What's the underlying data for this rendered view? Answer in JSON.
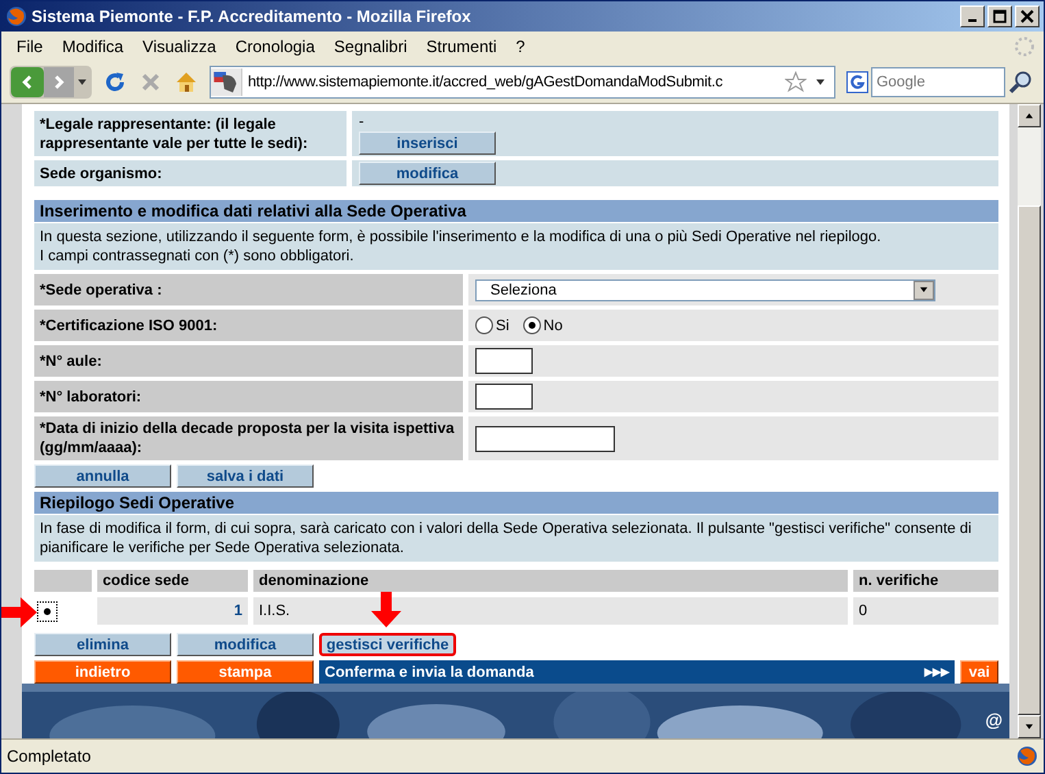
{
  "window": {
    "title": "Sistema Piemonte - F.P. Accreditamento - Mozilla Firefox"
  },
  "menu": [
    "File",
    "Modifica",
    "Visualizza",
    "Cronologia",
    "Segnalibri",
    "Strumenti",
    "?"
  ],
  "address_bar": {
    "value": "http://www.sistemapiemonte.it/accred_web/gAGestDomandaModSubmit.c"
  },
  "search": {
    "placeholder": "Google"
  },
  "top_rows": [
    {
      "label": "*Legale rappresentante: (il legale rappresentante vale per tutte le sedi):",
      "value": "-",
      "button": "inserisci"
    },
    {
      "label": "Sede organismo:",
      "button": "modifica"
    }
  ],
  "section": {
    "title": "Inserimento e modifica dati relativi alla Sede Operativa",
    "info": [
      "In questa sezione, utilizzando il seguente form, è possibile l'inserimento e la modifica di una o più Sedi Operative nel riepilogo.",
      "I campi contrassegnati con (*) sono obbligatori."
    ]
  },
  "form": [
    {
      "kind": "select",
      "label": "*Sede operativa :",
      "value": "Seleziona"
    },
    {
      "kind": "radio",
      "label": "*Certificazione ISO 9001:",
      "options": [
        {
          "label": "Si",
          "selected": false
        },
        {
          "label": "No",
          "selected": true
        }
      ]
    },
    {
      "kind": "short",
      "label": "*N° aule:"
    },
    {
      "kind": "short",
      "label": "*N° laboratori:"
    },
    {
      "kind": "long",
      "label": "*Data di inizio della decade proposta per la visita ispettiva (gg/mm/aaaa):"
    }
  ],
  "form_buttons": [
    "annulla",
    "salva i dati"
  ],
  "summary": {
    "title": "Riepilogo Sedi Operative",
    "info": "In fase di modifica il form, di cui sopra, sarà caricato con i valori della Sede Operativa selezionata. Il pulsante \"gestisci verifiche\" consente di pianificare le verifiche per Sede Operativa selezionata.",
    "columns": [
      "codice sede",
      "denominazione",
      "n. verifiche"
    ],
    "rows": [
      {
        "selected": true,
        "codice": "1",
        "denominazione": "I.I.S.",
        "verifiche": "0"
      }
    ]
  },
  "row_buttons": [
    {
      "label": "elimina",
      "highlighted": false
    },
    {
      "label": "modifica",
      "highlighted": false
    },
    {
      "label": "gestisci verifiche",
      "highlighted": true
    }
  ],
  "bottom_bar": {
    "buttons": [
      "indietro",
      "stampa"
    ],
    "confirm": "Conferma e invia la domanda",
    "arrows": "▶▶▶",
    "go": "vai"
  },
  "banner": {
    "mark": "@"
  },
  "status_bar": {
    "text": "Completato"
  }
}
